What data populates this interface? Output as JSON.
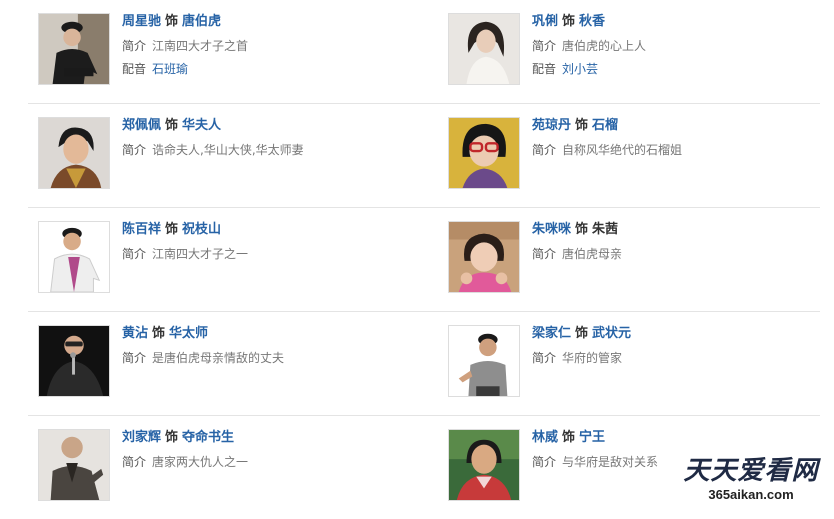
{
  "labels": {
    "as": "饰",
    "intro": "简介",
    "dub": "配音"
  },
  "cast": [
    {
      "left": {
        "actor": "周星驰",
        "role": "唐伯虎",
        "intro": "江南四大才子之首",
        "dub": "石班瑜",
        "photo_icon": "actor-photo-man-dark-jacket"
      },
      "right": {
        "actor": "巩俐",
        "role": "秋香",
        "intro": "唐伯虎的心上人",
        "dub": "刘小芸",
        "photo_icon": "actor-photo-woman-white"
      }
    },
    {
      "left": {
        "actor": "郑佩佩",
        "role": "华夫人",
        "intro": "诰命夫人,华山大侠,华太师妻",
        "photo_icon": "actor-photo-woman-short-hair"
      },
      "right": {
        "actor": "苑琼丹",
        "role": "石榴",
        "intro": "自称风华绝代的石榴姐",
        "photo_icon": "actor-photo-woman-red-glasses"
      }
    },
    {
      "left": {
        "actor": "陈百祥",
        "role": "祝枝山",
        "intro": "江南四大才子之一",
        "photo_icon": "actor-photo-man-white-suit"
      },
      "right": {
        "actor": "朱咪咪",
        "role": "朱茜",
        "intro": "唐伯虎母亲",
        "photo_icon": "actor-photo-woman-pink"
      }
    },
    {
      "left": {
        "actor": "黄沾",
        "role": "华太师",
        "intro": "是唐伯虎母亲情敌的丈夫",
        "photo_icon": "actor-photo-man-microphone"
      },
      "right": {
        "actor": "梁家仁",
        "role": "武状元",
        "intro": "华府的管家",
        "photo_icon": "actor-photo-man-grey-shirt"
      }
    },
    {
      "left": {
        "actor": "刘家辉",
        "role": "夺命书生",
        "intro": "唐家两大仇人之一",
        "photo_icon": "actor-photo-man-bald"
      },
      "right": {
        "actor": "林威",
        "role": "宁王",
        "intro": "与华府是敌对关系",
        "photo_icon": "actor-photo-man-red-shirt"
      }
    }
  ],
  "watermark": {
    "text": "天天爱看网",
    "url": "365aikan.com"
  },
  "colors": {
    "link": "#2763a6",
    "divider": "#e4e4e4",
    "text": "#777777"
  }
}
